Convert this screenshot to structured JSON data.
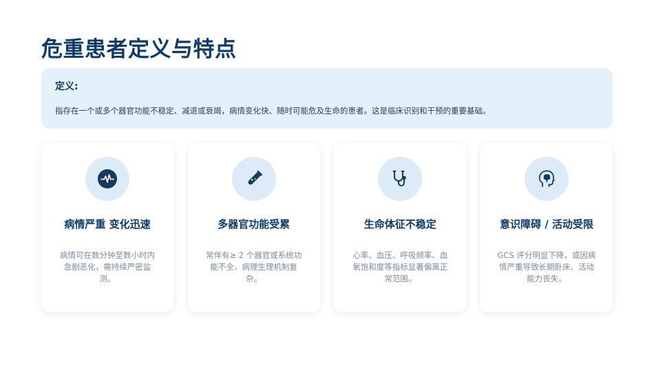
{
  "page": {
    "title": "危重患者定义与特点"
  },
  "definition": {
    "label": "定义:",
    "text": "指存在一个或多个器官功能不稳定、减退或衰竭，病情变化快、随时可能危及生命的患者。这是临床识别和干预的重要基础。"
  },
  "cards": [
    {
      "icon": "heartbeat-icon",
      "title": "病情严重 变化迅速",
      "description": "病情可在数分钟至数小时内急剧恶化，需持续严密监测。"
    },
    {
      "icon": "test-tube-icon",
      "title": "多器官功能受累",
      "description": "常伴有≥ 2 个器官或系统功能不全，病理生理机制复杂。"
    },
    {
      "icon": "stethoscope-icon",
      "title": "生命体征不稳定",
      "description": "心率、血压、呼吸频率、血氧饱和度等指标显著偏离正常范围。"
    },
    {
      "icon": "head-brain-icon",
      "title": "意识障碍 / 活动受限",
      "description": "GCS 评分明显下降，或因病情严重导致长期卧床、活动能力丧失。"
    }
  ],
  "colors": {
    "heading": "#0f3b66",
    "definition_bg": "#e4f1fb",
    "icon_bg": "#dcebf7",
    "icon_fg": "#143a5e",
    "muted_text": "#7a8a9a"
  }
}
